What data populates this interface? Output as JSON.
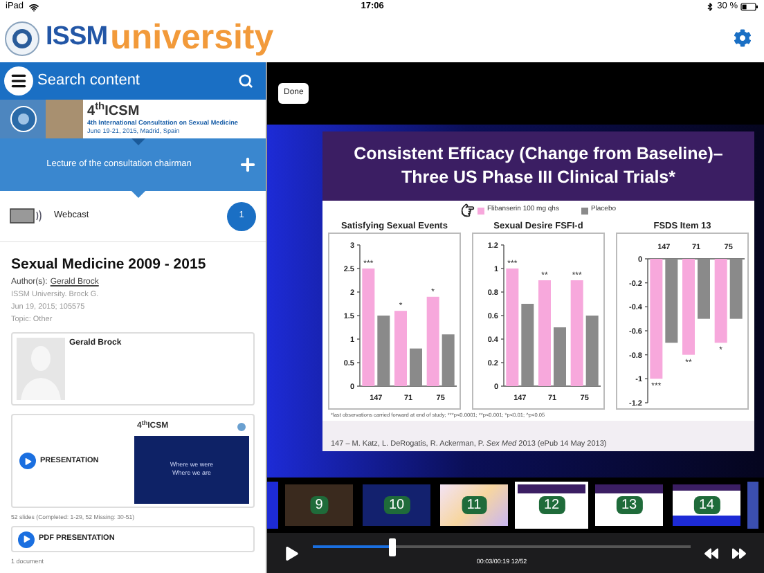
{
  "status_bar": {
    "device": "iPad",
    "time": "17:06",
    "battery": "30 %"
  },
  "header": {
    "logo_left": "ISSM",
    "logo_right": "university"
  },
  "sidebar": {
    "search": {
      "placeholder": "Search content"
    },
    "banner": {
      "title": "4$^{th}$ICSM",
      "subtitle": "4th International Consultation on Sexual Medicine",
      "dates": "June 19-21, 2015, Madrid, Spain"
    },
    "section": {
      "title": "Lecture of the consultation chairman"
    },
    "media": {
      "label": "Webcast",
      "count": "1"
    },
    "lecture": {
      "title": "Sexual Medicine 2009 - 2015",
      "author_label": "Author(s):",
      "author": "Gerald Brock",
      "meta": [
        "ISSM University. Brock G.",
        "Jun 19, 2015; 105575",
        "Topic: Other"
      ]
    },
    "speaker": {
      "name": "Gerald Brock"
    },
    "presentation": {
      "label": "PRESENTATION",
      "preview": {
        "logo": "4$^{th}$ICSM",
        "lines": [
          "Where we were",
          "Where we are"
        ]
      },
      "note": "52 slides (Completed: 1-29, 52 Missing: 30-51)"
    },
    "pdf": {
      "label": "PDF PRESENTATION",
      "note": "1 document"
    }
  },
  "player": {
    "done": "Done",
    "slide": {
      "title_lines": [
        "Consistent Efficacy (Change from Baseline)–",
        "Three US Phase III Clinical Trials*"
      ],
      "legend": [
        {
          "label": "Flibanserin 100 mg qhs",
          "color": "#f7a8dc"
        },
        {
          "label": "Placebo",
          "color": "#8a8a8a"
        }
      ],
      "charts": [
        {
          "chart_data": {
            "type": "bar",
            "title": "Satisfying Sexual Events",
            "categories": [
              "147",
              "71",
              "75"
            ],
            "series": [
              {
                "color": "#f7a8dc",
                "values": [
                  2.5,
                  1.6,
                  1.9
                ]
              },
              {
                "color": "#8a8a8a",
                "values": [
                  1.5,
                  0.8,
                  1.1
                ]
              }
            ],
            "ylim": [
              0,
              3
            ],
            "yticks": [
              0,
              0.5,
              1,
              1.5,
              2,
              2.5,
              3
            ],
            "annotations": [
              {
                "x": "147",
                "y": 2.5,
                "text": "***"
              },
              {
                "x": "71",
                "y": 1.6,
                "text": "*"
              },
              {
                "x": "75",
                "y": 1.9,
                "text": "*"
              }
            ]
          }
        },
        {
          "chart_data": {
            "type": "bar",
            "title": "Sexual Desire FSFI-d",
            "categories": [
              "147",
              "71",
              "75"
            ],
            "series": [
              {
                "color": "#f7a8dc",
                "values": [
                  1,
                  0.9,
                  0.9
                ]
              },
              {
                "color": "#8a8a8a",
                "values": [
                  0.7,
                  0.5,
                  0.6
                ]
              }
            ],
            "ylim": [
              0,
              1.2
            ],
            "yticks": [
              0,
              0.2,
              0.4,
              0.6,
              0.8,
              1,
              1.2
            ],
            "annotations": [
              {
                "x": "147",
                "y": 1,
                "text": "***"
              },
              {
                "x": "71",
                "y": 0.9,
                "text": "**"
              },
              {
                "x": "75",
                "y": 0.9,
                "text": "***"
              }
            ]
          }
        },
        {
          "chart_data": {
            "type": "bar",
            "title": "FSDS Item 13",
            "categories": [
              "147",
              "71",
              "75"
            ],
            "series": [
              {
                "color": "#f7a8dc",
                "values": [
                  -1,
                  -0.8,
                  -0.7
                ]
              },
              {
                "color": "#8a8a8a",
                "values": [
                  -0.7,
                  -0.5,
                  -0.5
                ]
              }
            ],
            "ylim": [
              -1.2,
              0
            ],
            "yticks": [
              0,
              -0.2,
              -0.4,
              -0.6,
              -0.8,
              -1,
              -1.2
            ],
            "annotations": [
              {
                "x": "147",
                "y": -1,
                "text": "***"
              },
              {
                "x": "71",
                "y": -0.8,
                "text": "**"
              },
              {
                "x": "75",
                "y": -0.7,
                "text": "*"
              }
            ]
          }
        }
      ],
      "footnote": "*last observations carried forward at end of study; ***p<0.0001; **p<0.001; *p<0.01; ^p<0.05",
      "reference": "147 – M. Katz, L. DeRogatis, R. Ackerman, P. *Sex Med* 2013 (ePub 14 May 2013)"
    },
    "thumbnails": [
      {
        "number": "9",
        "kind": "photo",
        "selected": false
      },
      {
        "number": "10",
        "kind": "title",
        "selected": false
      },
      {
        "number": "11",
        "kind": "diagram",
        "selected": false
      },
      {
        "number": "12",
        "kind": "chart",
        "selected": true
      },
      {
        "number": "13",
        "kind": "chart",
        "selected": false
      },
      {
        "number": "14",
        "kind": "list",
        "selected": false
      }
    ],
    "level": 0.21,
    "time": "00:03/00:19 12/52"
  }
}
